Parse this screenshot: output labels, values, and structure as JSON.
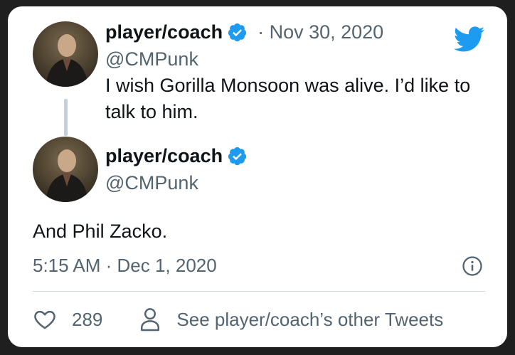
{
  "tweets": [
    {
      "display_name": "player/coach",
      "handle": "@CMPunk",
      "date": "· Nov 30, 2020",
      "text": "I wish Gorilla Monsoon was alive. I’d like to talk to him."
    },
    {
      "display_name": "player/coach",
      "handle": "@CMPunk",
      "text": "And Phil Zacko."
    }
  ],
  "timestamp": "5:15 AM · Dec 1, 2020",
  "footer": {
    "like_count": "289",
    "other_tweets_label": "See player/coach’s other Tweets"
  },
  "icons": {
    "verified": "verified-badge-icon",
    "brand": "twitter-bird-icon",
    "info": "info-icon",
    "like": "heart-icon",
    "profile": "person-icon"
  },
  "colors": {
    "twitter_blue": "#1d9bf0",
    "text_primary": "#0f1419",
    "text_secondary": "#536471",
    "thread_line": "#c7cfd6",
    "divider": "#cfd9de"
  }
}
